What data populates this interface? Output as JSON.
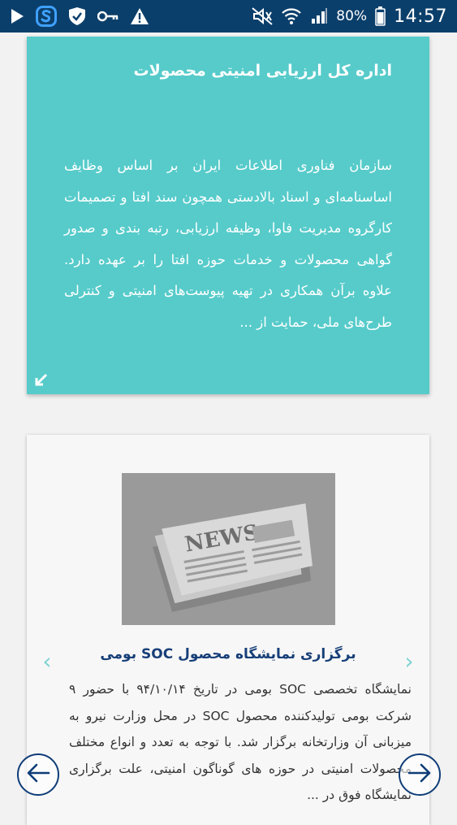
{
  "status_bar": {
    "battery_percent": "80%",
    "time": "14:57",
    "icons": [
      "play-icon",
      "s-app-icon",
      "shield-check-icon",
      "key-icon",
      "warning-icon",
      "mute-icon",
      "wifi-icon",
      "signal-icon",
      "battery-icon"
    ]
  },
  "teal_card": {
    "title": "اداره کل ارزیابی امنیتی محصولات",
    "body": "سازمان فناوری اطلاعات ایران بر اساس وظایف اساسنامه‌ای و اسناد بالادستی همچون سند افتا و تصمیمات کارگروه مدیریت فاوا، وظیفه ارزیابی، رتبه بندی و صدور گواهی محصولات و خدمات حوزه افتا را بر عهده دارد. علاوه برآن همکاری در تهیه پیوست‌های امنیتی و کنترلی طرح‌های ملی، حمایت از ...",
    "background": "#56cbca"
  },
  "news_card": {
    "image_text": "NEWS",
    "title": "برگزاری نمایشگاه محصول SOC بومی",
    "body": "نمایشگاه تخصصی SOC بومی در تاریخ ۹۴/۱۰/۱۴ با حضور ۹ شرکت بومی تولیدکننده محصول SOC در محل وزارت نیرو به میزبانی آن وزارتخانه برگزار شد. با توجه به تعدد و انواع مختلف محصولات امنیتی در حوزه های گوناگون امنیتی، علت برگزاری نمایشگاه فوق در ...",
    "prev_glyph": "‹",
    "next_glyph": "›",
    "title_color": "#173f78"
  },
  "nav": {
    "back_icon": "arrow-left-icon",
    "forward_icon": "arrow-right-icon",
    "accent": "#0f3d78"
  }
}
